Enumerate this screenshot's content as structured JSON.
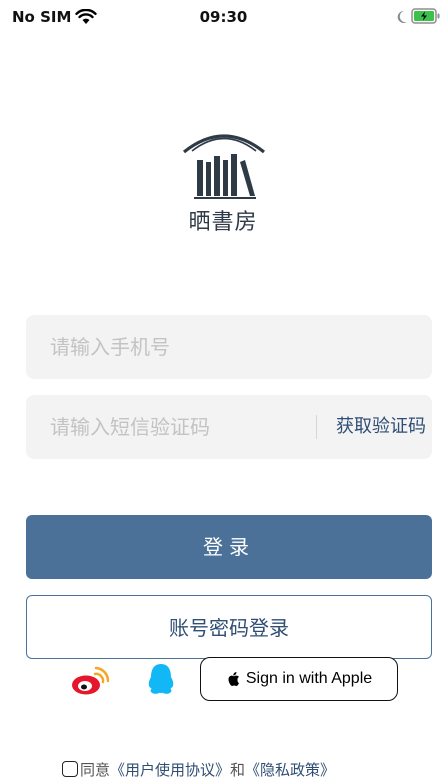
{
  "status_bar": {
    "carrier": "No SIM",
    "time": "09:30"
  },
  "logo": {
    "text": "晒書房"
  },
  "phone": {
    "placeholder": "请输入手机号"
  },
  "code": {
    "placeholder": "请输入短信验证码",
    "get_code_label": "获取验证码"
  },
  "buttons": {
    "login": "登录",
    "password_login": "账号密码登录",
    "apple": "Sign in with Apple"
  },
  "agreement": {
    "agree": "同意",
    "user_agreement": "《用户使用协议》",
    "and": "和",
    "privacy_policy": "《隐私政策》"
  },
  "colors": {
    "primary": "#4b7199",
    "link": "#2f4e74",
    "weibo": "#e6162d",
    "qq": "#12b7f5"
  },
  "icons": [
    "wifi-icon",
    "moon-icon",
    "battery-icon",
    "bookshelf-logo-icon",
    "weibo-icon",
    "qq-icon",
    "apple-icon"
  ]
}
